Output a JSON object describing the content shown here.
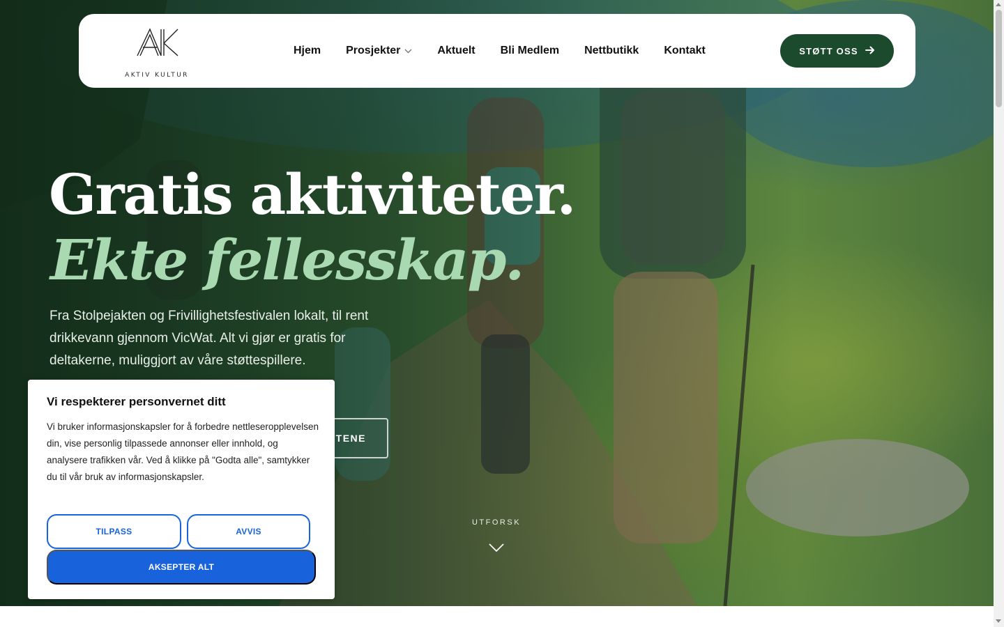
{
  "header": {
    "logo_text": "AKTIV KULTUR",
    "nav": [
      {
        "label": "Hjem"
      },
      {
        "label": "Prosjekter",
        "has_dropdown": true
      },
      {
        "label": "Aktuelt"
      },
      {
        "label": "Bli Medlem"
      },
      {
        "label": "Nettbutikk"
      },
      {
        "label": "Kontakt"
      }
    ],
    "cta_label": "STØTT OSS"
  },
  "hero": {
    "title_line1": "Gratis aktiviteter.",
    "title_line2": "Ekte fellesskap.",
    "lead": "Fra Stolpejakten og Frivillighetsfestivalen lokalt, til rent drikkevann gjennom VicWat. Alt vi gjør er gratis for deltakerne, muliggjort av våre støttespillere.",
    "secondary_button_visible_text": "ETENE",
    "explore_label": "UTFORSK"
  },
  "cookie_banner": {
    "title": "Vi respekterer personvernet ditt",
    "body": "Vi bruker informasjonskapsler for å forbedre nettleseropplevelsen din, vise personlig tilpassede annonser eller innhold, og analysere trafikken vår. Ved å klikke på \"Godta alle\", samtykker du til vår bruk av informasjonskapsler.",
    "customize_label": "TILPASS",
    "reject_label": "AVVIS",
    "accept_label": "AKSEPTER ALT"
  },
  "colors": {
    "brand_green": "#1c4a2c",
    "accent_mint": "#a9d9b0",
    "cookie_blue": "#1863dc"
  }
}
